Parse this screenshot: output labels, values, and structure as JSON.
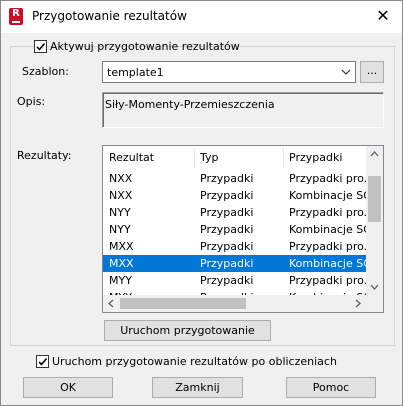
{
  "window": {
    "title": "Przygotowanie rezultatów",
    "close_label": "✕",
    "app_icon": "R"
  },
  "activate": {
    "label": "Aktywuj przygotowanie rezultatów",
    "checked": true
  },
  "template": {
    "label": "Szablon:",
    "value": "template1",
    "browse_label": "..."
  },
  "description": {
    "label": "Opis:",
    "value": "Siły-Momenty-Przemieszczenia"
  },
  "results": {
    "label": "Rezultaty:",
    "columns": [
      "Rezultat",
      "Typ",
      "Przypadki"
    ],
    "rows": [
      {
        "result": "NXX",
        "type": "Przypadki",
        "cases": "Przypadki pro..."
      },
      {
        "result": "NXX",
        "type": "Przypadki",
        "cases": "Kombinacje SGN"
      },
      {
        "result": "NYY",
        "type": "Przypadki",
        "cases": "Przypadki pro..."
      },
      {
        "result": "NYY",
        "type": "Przypadki",
        "cases": "Kombinacje SGN"
      },
      {
        "result": "MXX",
        "type": "Przypadki",
        "cases": "Przypadki pro..."
      },
      {
        "result": "MXX",
        "type": "Przypadki",
        "cases": "Kombinacje SGN",
        "selected": true
      },
      {
        "result": "MYY",
        "type": "Przypadki",
        "cases": "Przypadki pro..."
      },
      {
        "result": "MYY",
        "type": "Przypadki",
        "cases": "Kombinacje SGN"
      }
    ],
    "run_label": "Uruchom przygotowanie"
  },
  "after_calc": {
    "label": "Uruchom przygotowanie rezultatów po obliczeniach",
    "checked": true
  },
  "buttons": {
    "ok": "OK",
    "close": "Zamknij",
    "help": "Pomoc"
  },
  "colors": {
    "selection": "#0078d7",
    "brand": "#c8102e"
  }
}
